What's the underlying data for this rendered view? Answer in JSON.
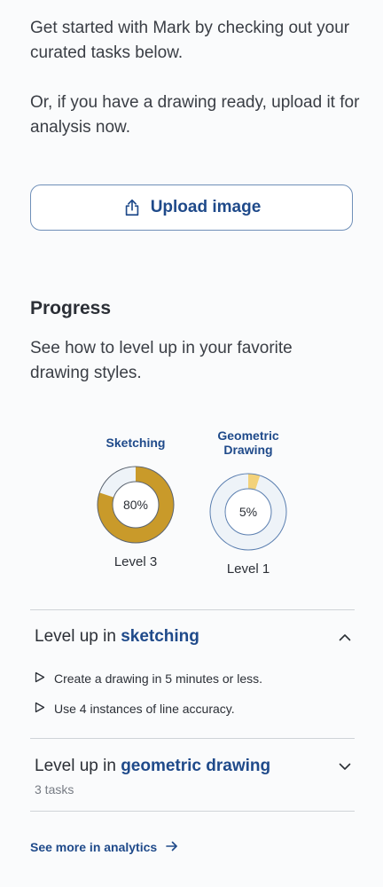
{
  "intro": {
    "line1": "Get started with Mark by checking out your curated tasks below.",
    "line2": "Or, if you have a drawing ready, upload it for analysis now."
  },
  "upload": {
    "label": "Upload image",
    "icon": "upload-icon"
  },
  "progress": {
    "title": "Progress",
    "description": "See how to level up in your favorite drawing styles.",
    "styles": [
      {
        "name": "Sketching",
        "percent_label": "80%",
        "percent": 80,
        "level": "Level 3",
        "color": "#c99a2a"
      },
      {
        "name": "Geometric Drawing",
        "percent_label": "5%",
        "percent": 5,
        "level": "Level 1",
        "color": "#f3d27a"
      }
    ]
  },
  "accordion": [
    {
      "prefix": "Level up in ",
      "highlight": "sketching",
      "expanded": true,
      "tasks": [
        "Create a drawing in 5 minutes or less.",
        "Use 4 instances of line accuracy."
      ]
    },
    {
      "prefix": "Level up in ",
      "highlight": "geometric drawing",
      "expanded": false,
      "count_label": "3 tasks"
    }
  ],
  "analytics_link": {
    "label": "See more in analytics"
  },
  "colors": {
    "accent": "#1f4a8a",
    "ring_track": "#eef3f8",
    "ring_border": "#5b7fb0"
  }
}
